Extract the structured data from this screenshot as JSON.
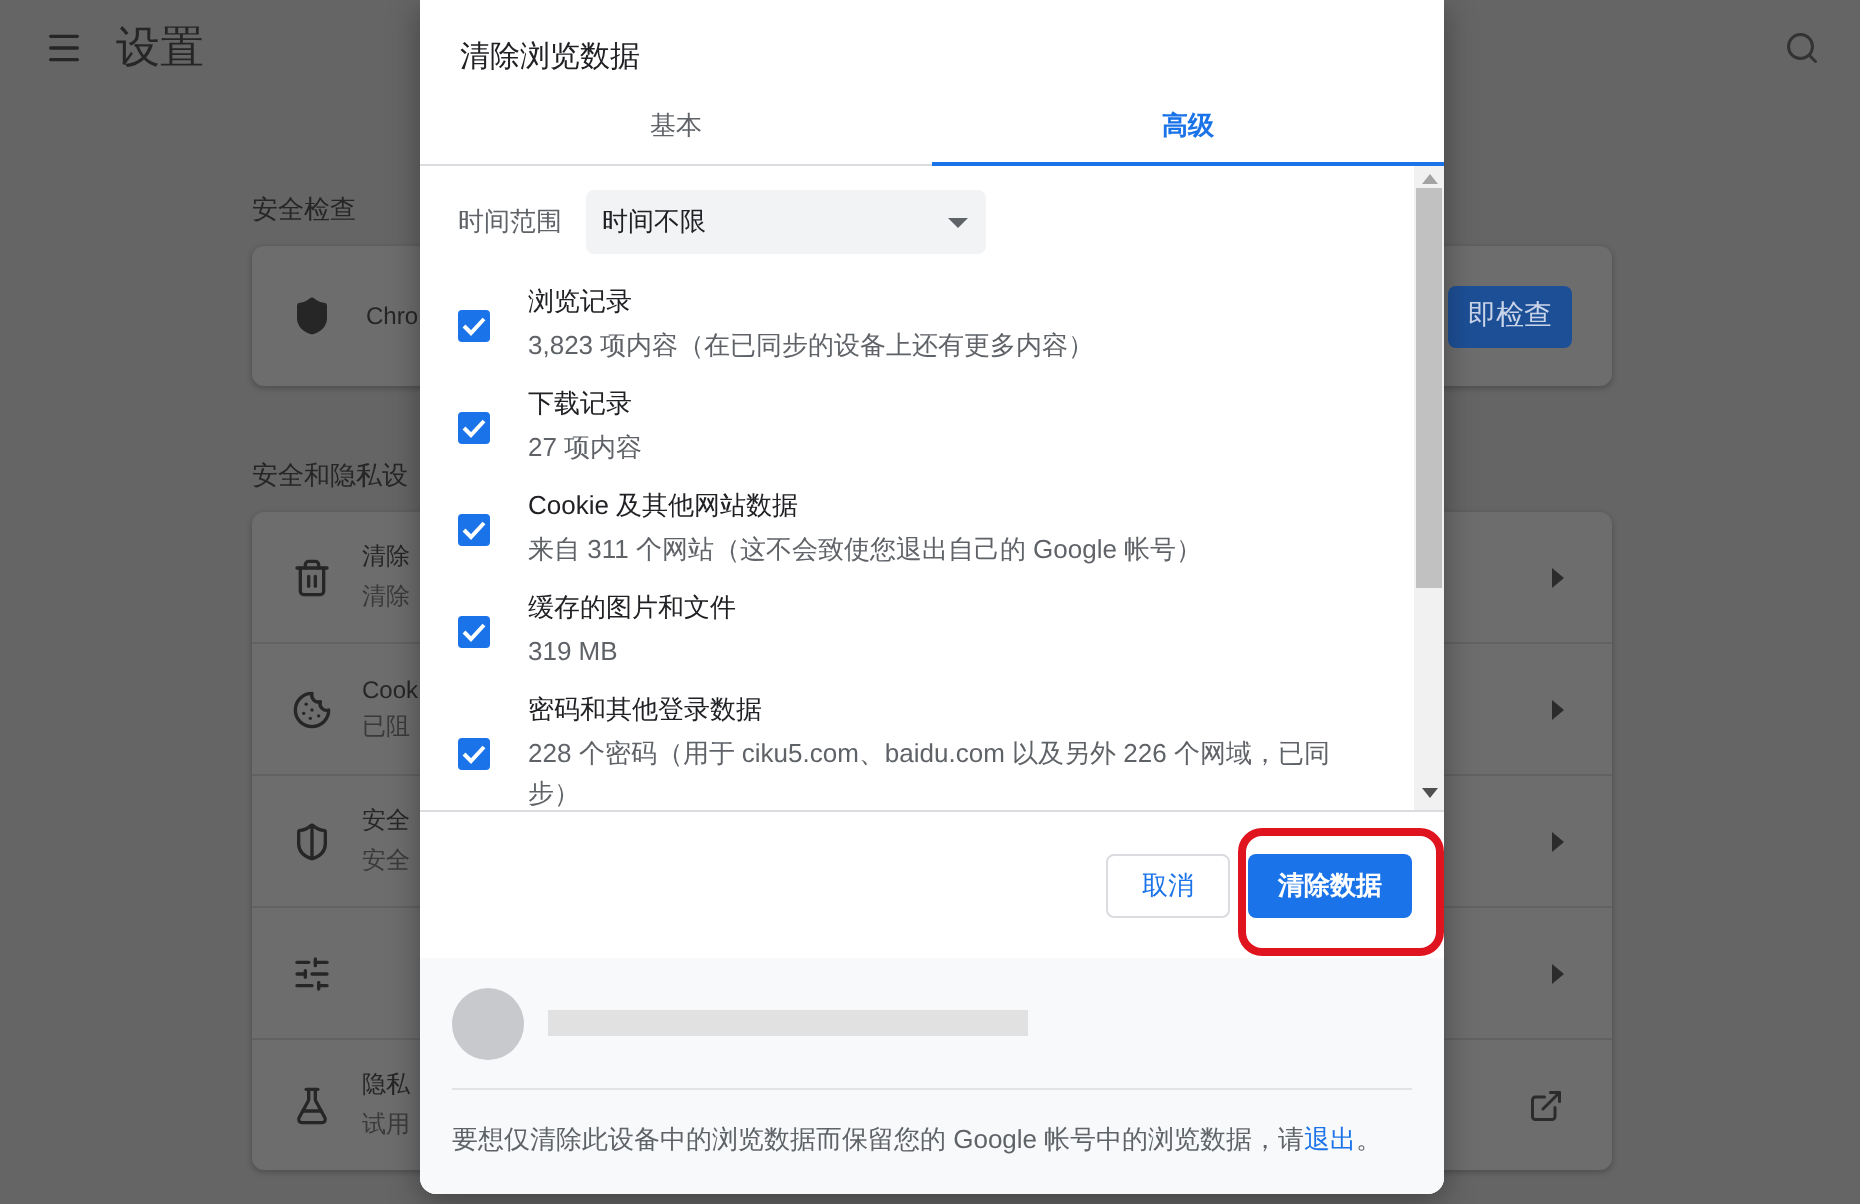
{
  "header": {
    "title": "设置"
  },
  "sections": [
    {
      "heading": "安全检查",
      "card": {
        "text": "Chro",
        "button": "即检查"
      }
    },
    {
      "heading": "安全和隐私设",
      "rows": [
        {
          "kind": "submenu",
          "title": "清除",
          "subtitle": "清除"
        },
        {
          "kind": "submenu",
          "title": "Cook",
          "subtitle": "已阻"
        },
        {
          "kind": "submenu",
          "title": "安全",
          "subtitle": "安全"
        },
        {
          "kind": "submenu"
        },
        {
          "kind": "external",
          "title": "隐私",
          "subtitle": "试用"
        }
      ]
    }
  ],
  "dialog": {
    "title": "清除浏览数据",
    "tabs": [
      {
        "label": "基本",
        "selected": false
      },
      {
        "label": "高级",
        "selected": true
      }
    ],
    "time_range": {
      "label": "时间范围",
      "value": "时间不限"
    },
    "items": [
      {
        "title": "浏览记录",
        "detail": "3,823 项内容（在已同步的设备上还有更多内容）",
        "checked": true
      },
      {
        "title": "下载记录",
        "detail": "27 项内容",
        "checked": true
      },
      {
        "title": "Cookie 及其他网站数据",
        "detail": "来自 311 个网站（这不会致使您退出自己的 Google 帐号）",
        "checked": true
      },
      {
        "title": "缓存的图片和文件",
        "detail": "319 MB",
        "checked": true
      },
      {
        "title": "密码和其他登录数据",
        "detail": "228 个密码（用于 ciku5.com、baidu.com 以及另外 226 个网域，已同步）",
        "checked": true
      }
    ],
    "cancel": "取消",
    "confirm": {
      "label": "清除数据",
      "highlighted": true
    },
    "note": {
      "text": "要想仅清除此设备中的浏览数据而保留您的 Google 帐号中的浏览数据，请",
      "link": "退出",
      "end": "。"
    }
  }
}
